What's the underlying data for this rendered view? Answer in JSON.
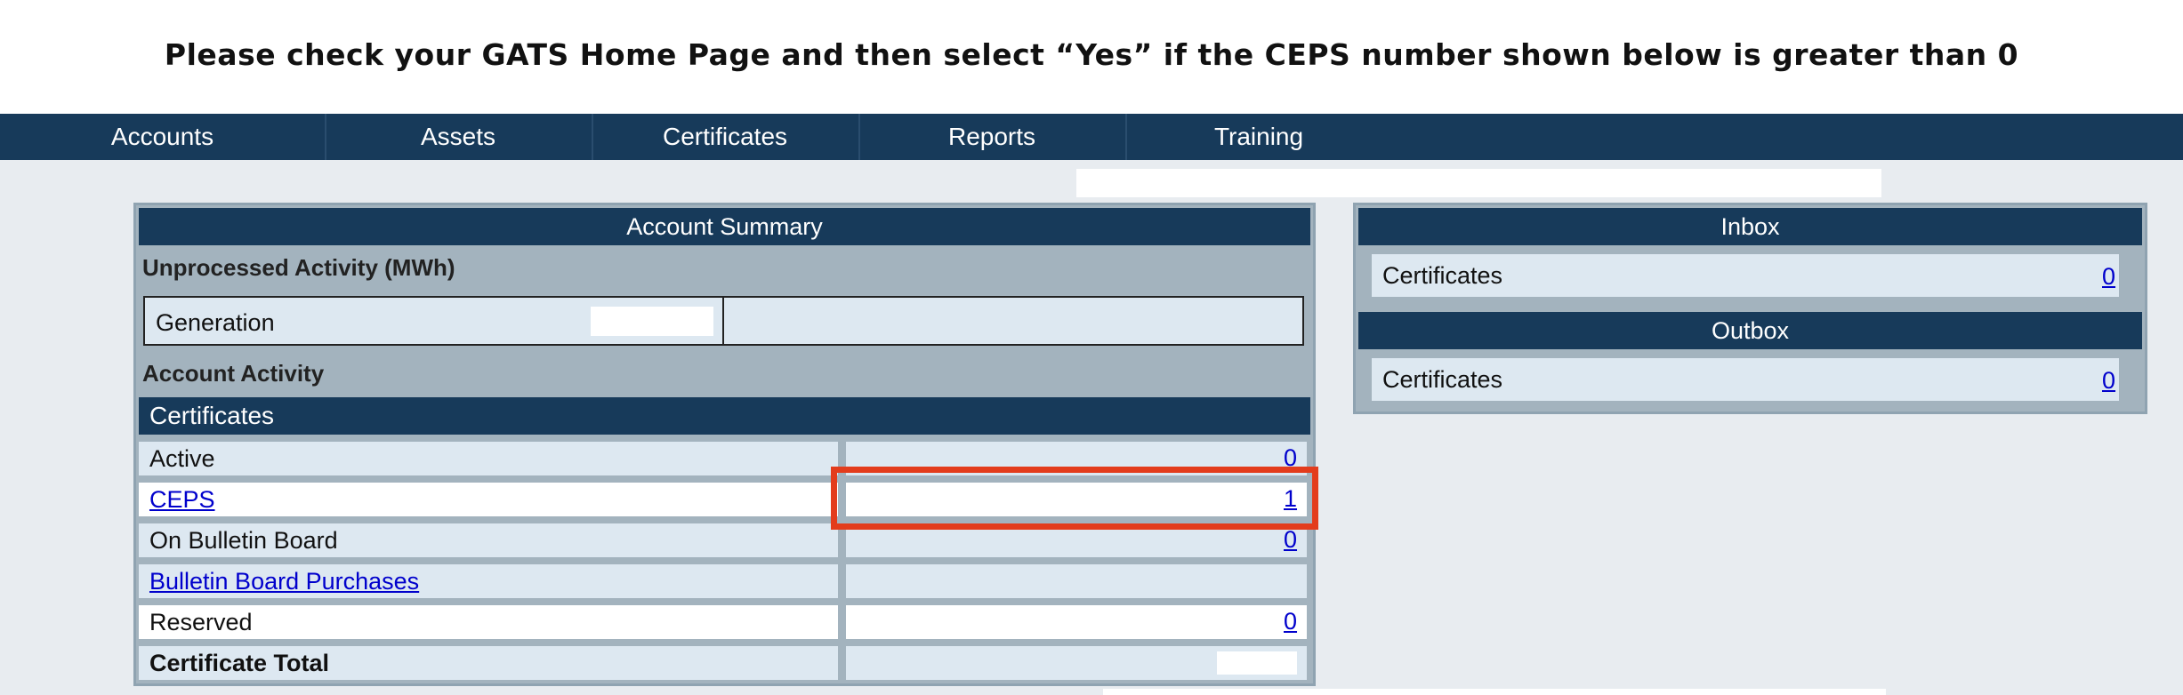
{
  "instruction": "Please check your GATS Home Page and then select “Yes” if the CEPS number shown below is greater than 0",
  "nav": {
    "items": [
      "Accounts",
      "Assets",
      "Certificates",
      "Reports",
      "Training"
    ]
  },
  "account_summary": {
    "title": "Account Summary",
    "unprocessed_label": "Unprocessed Activity (MWh)",
    "generation_label": "Generation",
    "activity_label": "Account Activity",
    "certificates_header": "Certificates",
    "rows": [
      {
        "label": "Active",
        "value": "0"
      },
      {
        "label": "CEPS",
        "value": "1"
      },
      {
        "label": "On Bulletin Board",
        "value": "0"
      },
      {
        "label": "Bulletin Board Purchases",
        "value": ""
      },
      {
        "label": "Reserved",
        "value": "0"
      },
      {
        "label": "Certificate Total",
        "value": ""
      }
    ]
  },
  "inbox": {
    "title": "Inbox",
    "label": "Certificates",
    "value": "0"
  },
  "outbox": {
    "title": "Outbox",
    "label": "Certificates",
    "value": "0"
  },
  "colors": {
    "nav_bg": "#173a5a",
    "panel_bg": "#a3b3be",
    "row_light": "#dde8f1",
    "link": "#0000cc",
    "highlight": "#e33c1c"
  }
}
